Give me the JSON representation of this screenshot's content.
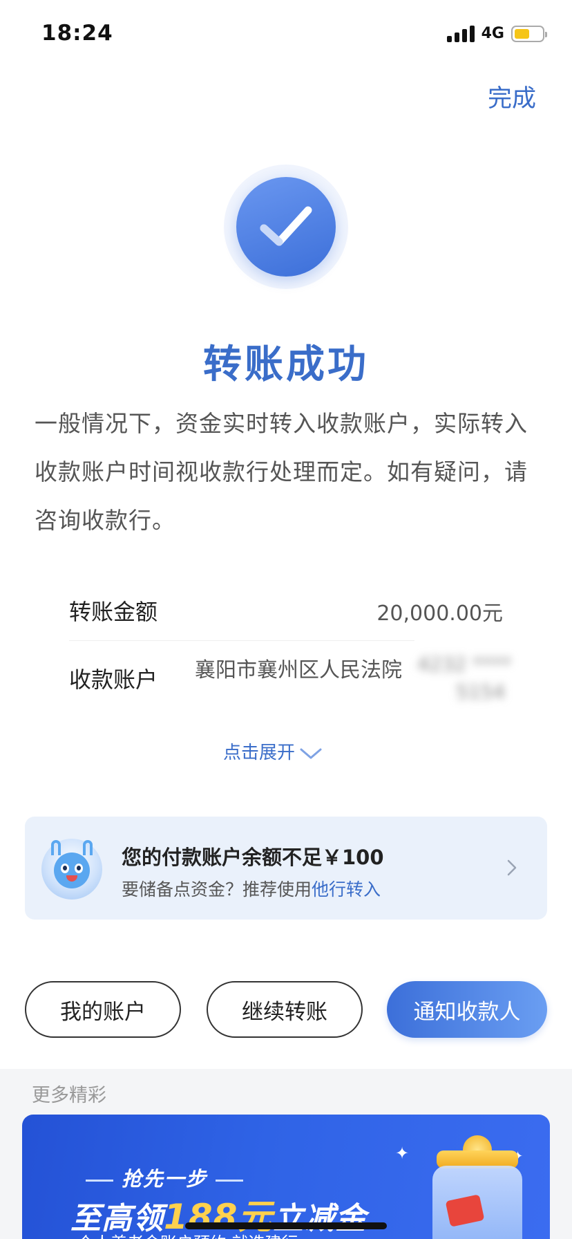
{
  "status_bar": {
    "time": "18:24",
    "network": "4G"
  },
  "header": {
    "done_label": "完成"
  },
  "result": {
    "title": "转账成功",
    "description": "一般情况下，资金实时转入收款账户，实际转入收款账户时间视收款行处理而定。如有疑问，请咨询收款行。"
  },
  "details": {
    "amount_label": "转账金额",
    "amount_value": "20,000.00元",
    "payee_label": "收款账户",
    "payee_name": "襄阳市襄州区人民法院",
    "payee_account_masked_1": "4232 ****",
    "payee_account_masked_2": "5154",
    "expand_label": "点击展开"
  },
  "notice": {
    "title": "您的付款账户余额不足￥100",
    "subtitle_prefix": "要储备点资金？推荐使用",
    "subtitle_link": "他行转入"
  },
  "actions": {
    "my_account": "我的账户",
    "continue_transfer": "继续转账",
    "notify_payee": "通知收款人"
  },
  "more": {
    "label": "更多精彩",
    "banner": {
      "top_text": "抢先一步",
      "main_prefix": "至高领",
      "main_highlight": "188元",
      "main_suffix": "立减金",
      "sub_text": "个人养老金账户预约 就选建行"
    }
  },
  "colors": {
    "accent": "#3a6dc9",
    "battery": "#f5c518",
    "banner": "#2452d6"
  }
}
